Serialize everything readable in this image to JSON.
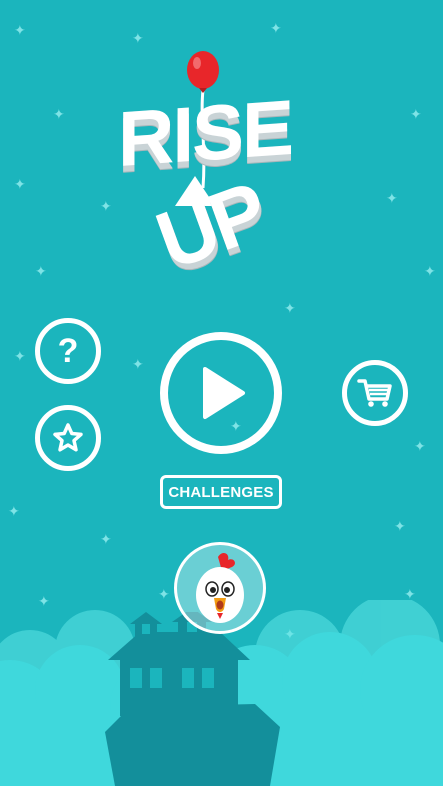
{
  "title": {
    "line1": "RISE",
    "line2": "UP"
  },
  "menu": {
    "play_label": "play",
    "help_label": "?",
    "challenges_label": "CHALLENGES"
  },
  "icons": {
    "help": "question-mark-icon",
    "rate": "star-icon",
    "play": "play-icon",
    "shop": "shopping-cart-icon",
    "character": "chicken-character-icon",
    "balloon": "red-balloon-icon"
  },
  "colors": {
    "background": "#1bb5bd",
    "sparkle": "#7ee3e6",
    "cloud": "#3fd8dc",
    "cloud_light": "#5ee6e6",
    "house": "#138f9b",
    "balloon": "#e8262a",
    "accent_white": "#ffffff"
  }
}
